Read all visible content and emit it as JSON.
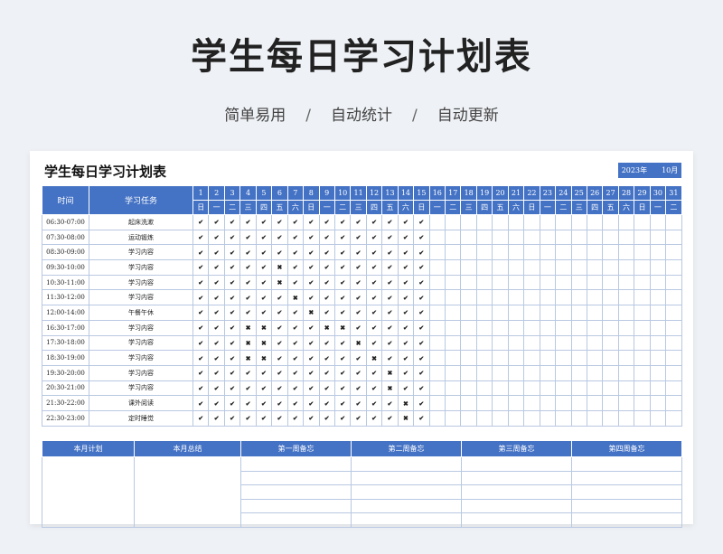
{
  "banner": {
    "title": "学生每日学习计划表",
    "tags": [
      "简单易用",
      "自动统计",
      "自动更新"
    ],
    "separator": "/"
  },
  "sheet": {
    "title": "学生每日学习计划表",
    "year": "2023年",
    "month": "10月",
    "col_time": "时间",
    "col_task": "学习任务",
    "days": [
      "1",
      "2",
      "3",
      "4",
      "5",
      "6",
      "7",
      "8",
      "9",
      "10",
      "11",
      "12",
      "13",
      "14",
      "15",
      "16",
      "17",
      "18",
      "19",
      "20",
      "21",
      "22",
      "23",
      "24",
      "25",
      "26",
      "27",
      "28",
      "29",
      "30",
      "31"
    ],
    "weekdays": [
      "日",
      "一",
      "二",
      "三",
      "四",
      "五",
      "六",
      "日",
      "一",
      "二",
      "三",
      "四",
      "五",
      "六",
      "日",
      "一",
      "二",
      "三",
      "四",
      "五",
      "六",
      "日",
      "一",
      "二",
      "三",
      "四",
      "五",
      "六",
      "日",
      "一",
      "二"
    ],
    "rows": [
      {
        "time": "06:30-07:00",
        "task": "起床洗漱",
        "marks": "111111111111111"
      },
      {
        "time": "07:30-08:00",
        "task": "运动锻炼",
        "marks": "111111111111111"
      },
      {
        "time": "08:30-09:00",
        "task": "学习内容",
        "marks": "111111111111111"
      },
      {
        "time": "09:30-10:00",
        "task": "学习内容",
        "marks": "111117111111111"
      },
      {
        "time": "10:30-11:00",
        "task": "学习内容",
        "marks": "111117111111111"
      },
      {
        "time": "11:30-12:00",
        "task": "学习内容",
        "marks": "111111711111111"
      },
      {
        "time": "12:00-14:00",
        "task": "午餐午休",
        "marks": "111111171111111"
      },
      {
        "time": "16:30-17:00",
        "task": "学习内容",
        "marks": "111771117711111"
      },
      {
        "time": "17:30-18:00",
        "task": "学习内容",
        "marks": "111771111171111"
      },
      {
        "time": "18:30-19:00",
        "task": "学习内容",
        "marks": "111771111117111"
      },
      {
        "time": "19:30-20:00",
        "task": "学习内容",
        "marks": "111111111111711"
      },
      {
        "time": "20:30-21:00",
        "task": "学习内容",
        "marks": "111111111111711"
      },
      {
        "time": "21:30-22:00",
        "task": "课外阅读",
        "marks": "111111111111171"
      },
      {
        "time": "22:30-23:00",
        "task": "定时睡觉",
        "marks": "111111111111171"
      }
    ]
  },
  "notes": {
    "headers": [
      "本月计划",
      "本月总结",
      "第一周备忘",
      "第二周备忘",
      "第三周备忘",
      "第四周备忘"
    ]
  },
  "symbols": {
    "check": "✔",
    "cross": "✖"
  },
  "colors": {
    "header_blue": "#4472c4",
    "check_green": "#3c9a6e",
    "cross_red": "#d9463b",
    "grid_line": "#b9c8e2"
  }
}
